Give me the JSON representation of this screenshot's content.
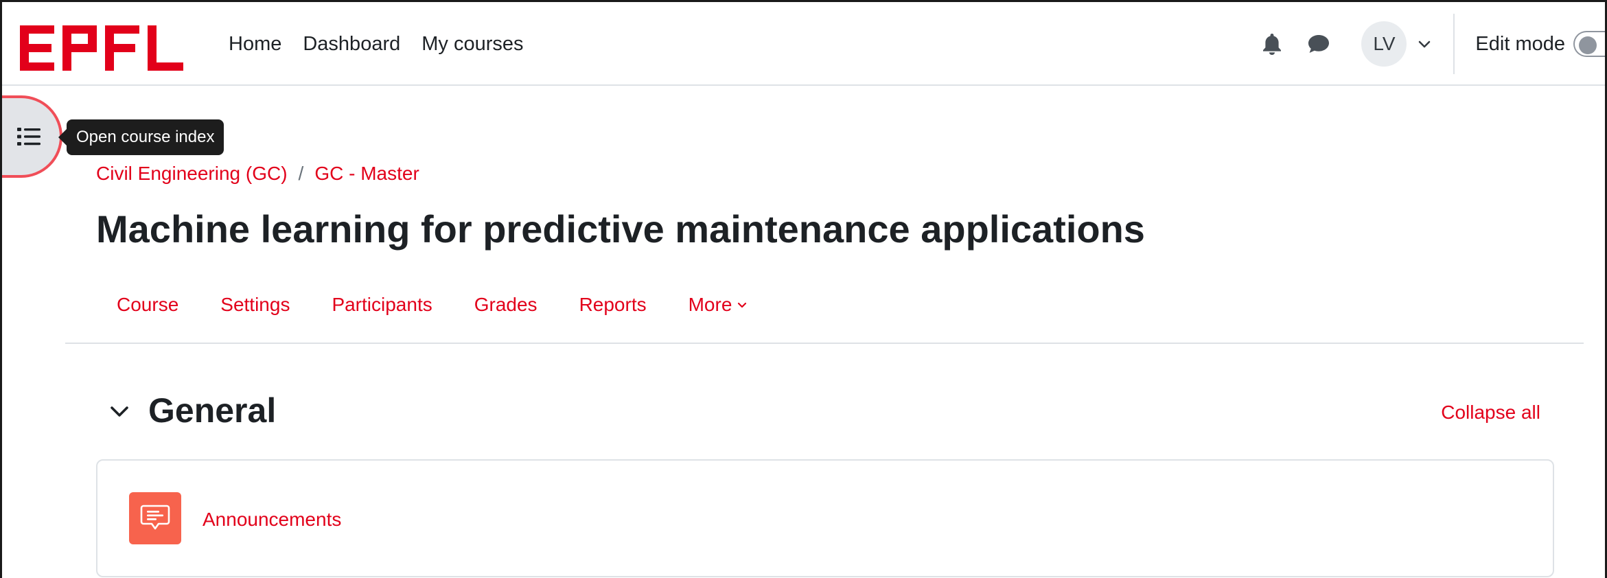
{
  "brand": {
    "logo_text": "EPFL",
    "color": "#e2001a"
  },
  "navbar": {
    "links": [
      "Home",
      "Dashboard",
      "My courses"
    ],
    "user_initials": "LV",
    "edit_mode_label": "Edit mode"
  },
  "icons": {
    "course_index": "list-icon",
    "notifications": "bell-icon",
    "messages": "chat-icon",
    "user_menu": "chevron-down-icon",
    "section_toggle": "chevron-down-icon",
    "activity": "forum-icon"
  },
  "course_index": {
    "tooltip": "Open course index"
  },
  "breadcrumb": {
    "items": [
      "Civil Engineering (GC)",
      "GC - Master"
    ],
    "separator": "/"
  },
  "page": {
    "title": "Machine learning for predictive maintenance applications"
  },
  "secondary_nav": {
    "tabs": [
      "Course",
      "Settings",
      "Participants",
      "Grades",
      "Reports",
      "More"
    ]
  },
  "section": {
    "title": "General",
    "collapse_all": "Collapse all",
    "activities": [
      {
        "name": "Announcements",
        "icon_color": "#f7634d"
      }
    ]
  }
}
